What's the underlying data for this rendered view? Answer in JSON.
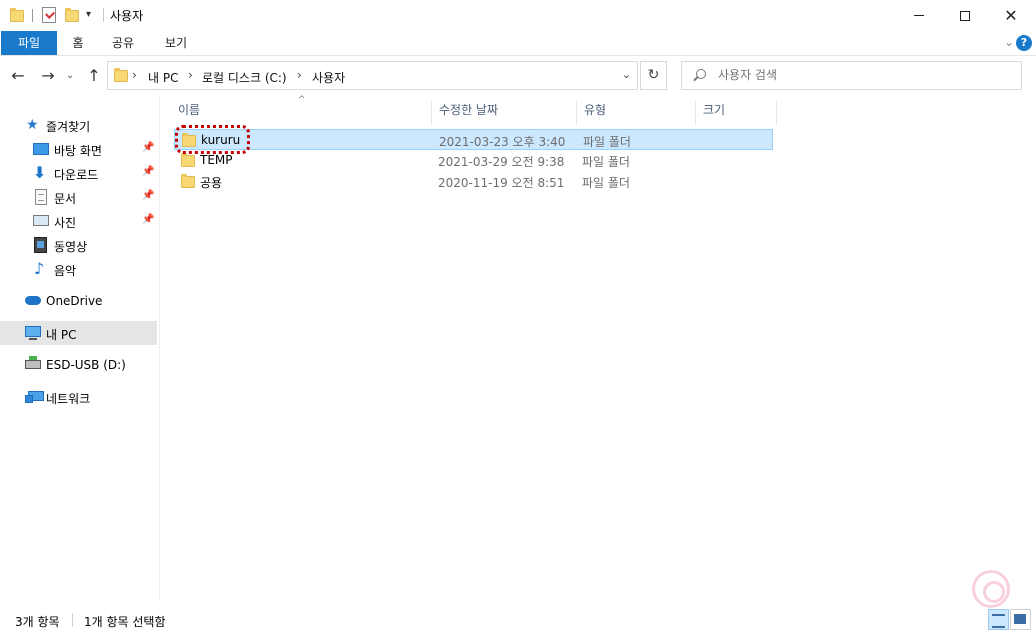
{
  "window": {
    "title": "사용자",
    "minimize_icon": "minimize-icon",
    "maximize_icon": "maximize-icon",
    "close_icon": "close-icon"
  },
  "ribbon": {
    "tabs": [
      {
        "label": "파일"
      },
      {
        "label": "홈"
      },
      {
        "label": "공유"
      },
      {
        "label": "보기"
      }
    ],
    "help_label": "?"
  },
  "address_bar": {
    "breadcrumbs": [
      "내 PC",
      "로컬 디스크 (C:)",
      "사용자"
    ],
    "separator": "›"
  },
  "search": {
    "placeholder": "사용자 검색"
  },
  "nav_pane": {
    "quick_access": "즐겨찾기",
    "pinned": [
      {
        "label": "바탕 화면",
        "icon": "desktop-icon"
      },
      {
        "label": "다운로드",
        "icon": "download-icon"
      },
      {
        "label": "문서",
        "icon": "documents-icon"
      },
      {
        "label": "사진",
        "icon": "pictures-icon"
      }
    ],
    "unpinned": [
      {
        "label": "동영상",
        "icon": "videos-icon"
      },
      {
        "label": "음악",
        "icon": "music-icon"
      }
    ],
    "onedrive": "OneDrive",
    "this_pc": "내 PC",
    "usb": "ESD-USB (D:)",
    "network": "네트워크"
  },
  "columns": {
    "name": "이름",
    "date": "수정한 날짜",
    "type": "유형",
    "size": "크기"
  },
  "files": [
    {
      "name": "kururu",
      "date": "2021-03-23 오후 3:40",
      "type": "파일 폴더",
      "selected": true
    },
    {
      "name": "TEMP",
      "date": "2021-03-29 오전 9:38",
      "type": "파일 폴더",
      "selected": false
    },
    {
      "name": "공용",
      "date": "2020-11-19 오전 8:51",
      "type": "파일 폴더",
      "selected": false
    }
  ],
  "status": {
    "item_count": "3개 항목",
    "selection": "1개 항목 선택함"
  },
  "colors": {
    "accent": "#1979ca",
    "selection_bg": "#cce8ff",
    "highlight_ring": "#c40000"
  }
}
